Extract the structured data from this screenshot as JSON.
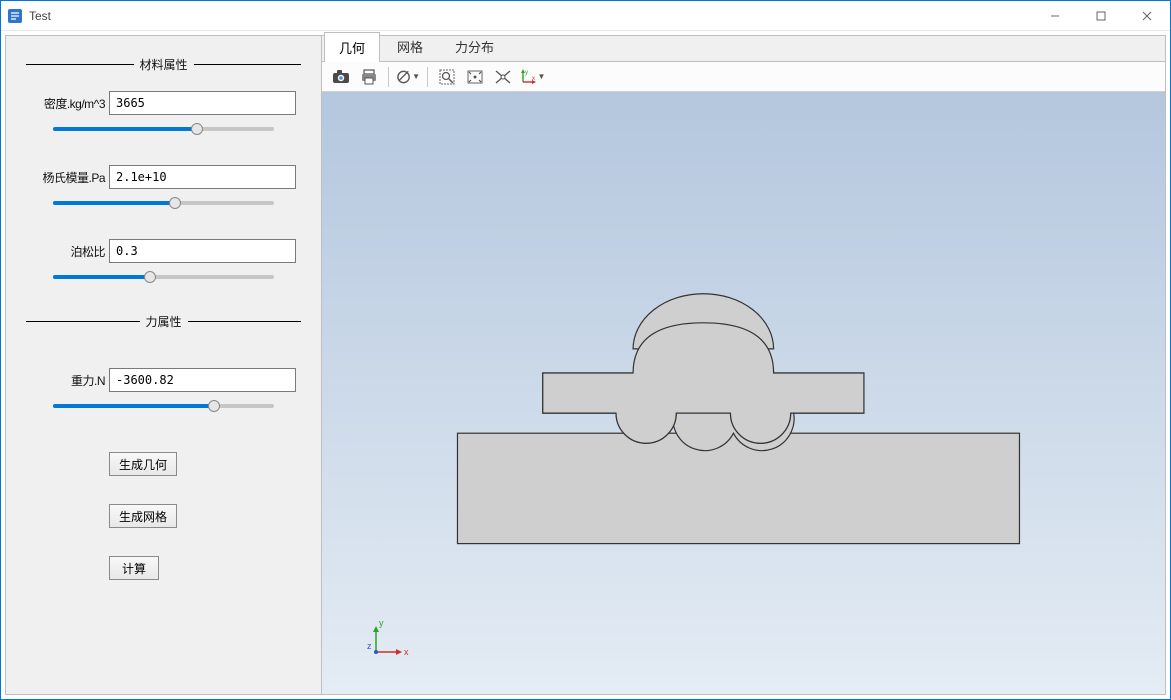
{
  "window": {
    "title": "Test"
  },
  "win_controls": {
    "min_tip": "Minimize",
    "max_tip": "Maximize",
    "close_tip": "Close"
  },
  "left": {
    "group_material": "材料属性",
    "group_force": "力属性",
    "density_label": "密度.kg/m^3",
    "density_value": "3665",
    "density_pct": 65,
    "young_label": "杨氏模量.Pa",
    "young_value": "2.1e+10",
    "young_pct": 55,
    "poisson_label": "泊松比",
    "poisson_value": "0.3",
    "poisson_pct": 44,
    "gravity_label": "重力.N",
    "gravity_value": "-3600.82",
    "gravity_pct": 73,
    "btn_geom": "生成几何",
    "btn_mesh": "生成网格",
    "btn_calc": "计算"
  },
  "tabs": {
    "geometry": "几何",
    "mesh": "网格",
    "force": "力分布",
    "active": "geometry"
  },
  "toolbar": {
    "camera_icon": "camera",
    "print_icon": "print",
    "render_icon": "render-mode",
    "zoom_area_icon": "zoom-area",
    "fit_icon": "fit-view",
    "orient_icon": "orient",
    "axes_icon": "axes-preset"
  },
  "axes": {
    "x": "x",
    "y": "y",
    "z": "z"
  },
  "colors": {
    "accent": "#0078d7",
    "axis_x": "#d02c2c",
    "axis_y": "#2da22d",
    "axis_z": "#2c56d0",
    "shape_fill": "#cfcfcf",
    "shape_stroke": "#333333"
  }
}
